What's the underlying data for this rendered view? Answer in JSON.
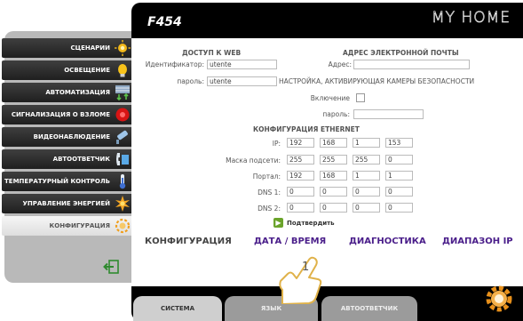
{
  "header": {
    "model": "F454",
    "brand": "MY HOME"
  },
  "sidebar": {
    "items": [
      {
        "label": "СЦЕНАРИИ",
        "icon": "scenario-icon",
        "active": false
      },
      {
        "label": "ОСВЕЩЕНИЕ",
        "icon": "lightbulb-icon",
        "active": false
      },
      {
        "label": "АВТОМАТИЗАЦИЯ",
        "icon": "shutter-icon",
        "active": false
      },
      {
        "label": "СИГНАЛИЗАЦИЯ О ВЗЛОМЕ",
        "icon": "alarm-icon",
        "active": false
      },
      {
        "label": "ВИДЕОНАБЛЮДЕНИЕ",
        "icon": "camera-icon",
        "active": false
      },
      {
        "label": "АВТООТВЕТЧИК",
        "icon": "answering-machine-icon",
        "active": false
      },
      {
        "label": "ТЕМПЕРАТУРНЫЙ КОНТРОЛЬ",
        "icon": "thermometer-icon",
        "active": false
      },
      {
        "label": "УПРАВЛЕНИЕ ЭНЕРГИЕЙ",
        "icon": "energy-icon",
        "active": false
      },
      {
        "label": "КОНФИГУРАЦИЯ",
        "icon": "configuration-icon",
        "active": true
      }
    ],
    "exit_icon": "exit-icon"
  },
  "web_access": {
    "heading": "ДОСТУП К WEB",
    "id_label": "Идентификатор:",
    "id_value": "utente",
    "password_label": "пароль:",
    "password_value": "utente"
  },
  "email": {
    "heading": "АДРЕС ЭЛЕКТРОННОЙ ПОЧТЫ",
    "address_label": "Адрес:",
    "address_value": "",
    "camera_setting": "НАСТРОЙКА, АКТИВИРУЮЩАЯ КАМЕРЫ БЕЗОПАСНОСТИ",
    "enable_label": "Включение",
    "password_label": "пароль:",
    "password_value": ""
  },
  "ethernet": {
    "heading": "КОНФИГУРАЦИЯ ETHERNET",
    "rows": [
      {
        "label": "IP:",
        "values": [
          "192",
          "168",
          "1",
          "153"
        ]
      },
      {
        "label": "Маска подсети:",
        "values": [
          "255",
          "255",
          "255",
          "0"
        ]
      },
      {
        "label": "Портал:",
        "values": [
          "192",
          "168",
          "1",
          "1"
        ]
      },
      {
        "label": "DNS 1:",
        "values": [
          "0",
          "0",
          "0",
          "0"
        ]
      },
      {
        "label": "DNS 2:",
        "values": [
          "0",
          "0",
          "0",
          "0"
        ]
      }
    ],
    "confirm_label": "Подтвердить"
  },
  "nav_links": [
    {
      "label": "КОНФИГУРАЦИЯ",
      "current": true
    },
    {
      "label": "ДАТА / ВРЕМЯ",
      "current": false
    },
    {
      "label": "ДИАГНОСТИКА",
      "current": false
    },
    {
      "label": "ДИАПАЗОН IP",
      "current": false
    }
  ],
  "bottom_tabs": [
    {
      "label": "СИСТЕМА",
      "active": true
    },
    {
      "label": "ЯЗЫК",
      "active": false
    },
    {
      "label": "АВТООТВЕТЧИК",
      "active": false
    }
  ],
  "annotation": {
    "number": "1"
  },
  "colors": {
    "nav_link": "#4a1e8a",
    "sidebar": "#2a2a2a",
    "frame": "#000000"
  }
}
